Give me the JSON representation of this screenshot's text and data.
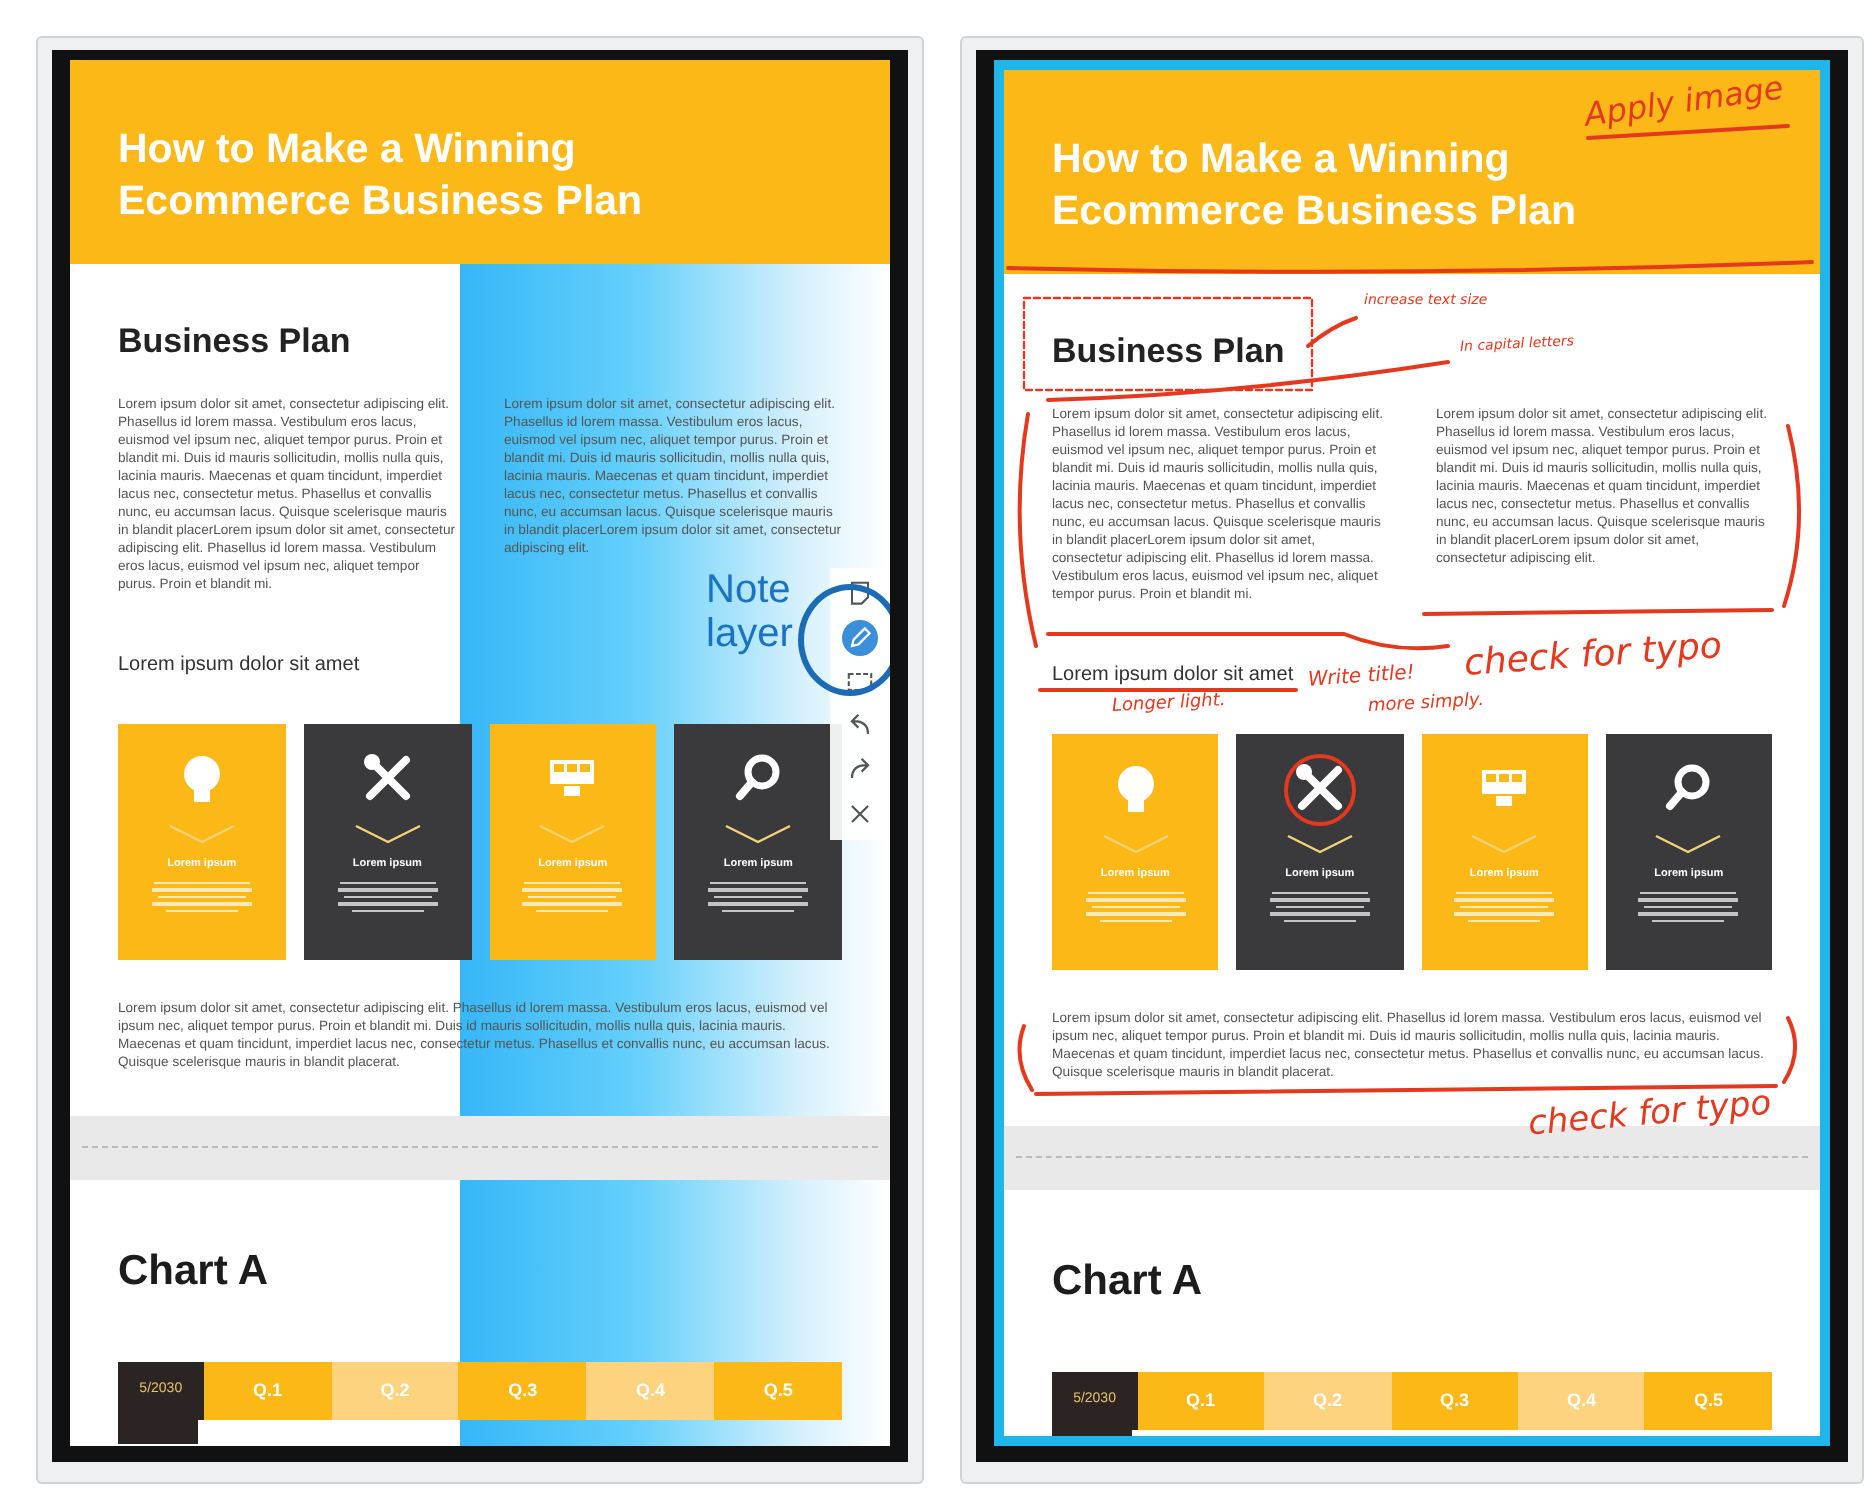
{
  "devices": [
    {
      "document": {
        "title_lines": [
          "How to Make a Winning",
          "Ecommerce Business Plan"
        ],
        "section_title": "Business Plan",
        "columns": [
          "Lorem ipsum dolor sit amet, consectetur adipiscing elit. Phasellus id lorem massa. Vestibulum eros lacus, euismod vel ipsum nec, aliquet tempor purus. Proin et blandit mi. Duis id mauris sollicitudin, mollis nulla quis, lacinia mauris. Maecenas et quam tincidunt, imperdiet lacus nec, consectetur metus. Phasellus et convallis nunc, eu accumsan lacus. Quisque scelerisque mauris in blandit placerLorem ipsum dolor sit amet, consectetur adipiscing elit. Phasellus id lorem massa. Vestibulum eros lacus, euismod vel ipsum nec, aliquet tempor purus. Proin et blandit mi.",
          "Lorem ipsum dolor sit amet, consectetur adipiscing elit. Phasellus id lorem massa. Vestibulum eros lacus, euismod vel ipsum nec, aliquet tempor purus. Proin et blandit mi. Duis id mauris sollicitudin, mollis nulla quis, lacinia mauris. Maecenas et quam tincidunt, imperdiet lacus nec, consectetur metus. Phasellus et convallis nunc, eu accumsan lacus. Quisque scelerisque mauris in blandit placerLorem ipsum dolor sit amet, consectetur adipiscing elit."
        ],
        "subheading": "Lorem ipsum dolor sit amet",
        "cards": [
          {
            "title": "Lorem ipsum",
            "kind": "light"
          },
          {
            "title": "Lorem ipsum",
            "kind": "dark"
          },
          {
            "title": "Lorem ipsum",
            "kind": "light"
          },
          {
            "title": "Lorem ipsum",
            "kind": "dark"
          }
        ],
        "paragraph": "Lorem ipsum dolor sit amet, consectetur adipiscing elit. Phasellus id lorem massa. Vestibulum eros lacus, euismod vel ipsum nec, aliquet tempor purus. Proin et blandit mi. Duis id mauris sollicitudin, mollis nulla quis, lacinia mauris. Maecenas et quam tincidunt, imperdiet lacus nec, consectetur metus. Phasellus et convallis nunc, eu accumsan lacus. Quisque scelerisque mauris in blandit placerat.",
        "chart_title": "Chart A",
        "table_header": [
          {
            "text": "5/2030",
            "kind": "label"
          },
          {
            "text": "Q.1",
            "kind": "strong"
          },
          {
            "text": "Q.2",
            "kind": "pale"
          },
          {
            "text": "Q.3",
            "kind": "strong"
          },
          {
            "text": "Q.4",
            "kind": "pale"
          },
          {
            "text": "Q.5",
            "kind": "strong"
          }
        ]
      },
      "note_layer": {
        "label": "Note layer",
        "tools": [
          {
            "kind": "note",
            "selected": false
          },
          {
            "kind": "pen",
            "selected": true
          },
          {
            "kind": "select",
            "selected": false
          },
          {
            "kind": "undo",
            "selected": false
          },
          {
            "kind": "redo",
            "selected": false
          },
          {
            "kind": "close",
            "selected": false
          }
        ]
      }
    },
    {
      "document": {
        "title_lines": [
          "How to Make a Winning",
          "Ecommerce Business Plan"
        ],
        "section_title": "Business Plan",
        "columns": [
          "Lorem ipsum dolor sit amet, consectetur adipiscing elit. Phasellus id lorem massa. Vestibulum eros lacus, euismod vel ipsum nec, aliquet tempor purus. Proin et blandit mi. Duis id mauris sollicitudin, mollis nulla quis, lacinia mauris. Maecenas et quam tincidunt, imperdiet lacus nec, consectetur metus. Phasellus et convallis nunc, eu accumsan lacus. Quisque scelerisque mauris in blandit placerLorem ipsum dolor sit amet, consectetur adipiscing elit. Phasellus id lorem massa. Vestibulum eros lacus, euismod vel ipsum nec, aliquet tempor purus. Proin et blandit mi.",
          "Lorem ipsum dolor sit amet, consectetur adipiscing elit. Phasellus id lorem massa. Vestibulum eros lacus, euismod vel ipsum nec, aliquet tempor purus. Proin et blandit mi. Duis id mauris sollicitudin, mollis nulla quis, lacinia mauris. Maecenas et quam tincidunt, imperdiet lacus nec, consectetur metus. Phasellus et convallis nunc, eu accumsan lacus. Quisque scelerisque mauris in blandit placerLorem ipsum dolor sit amet, consectetur adipiscing elit."
        ],
        "subheading": "Lorem ipsum dolor sit amet",
        "cards": [
          {
            "title": "Lorem ipsum",
            "kind": "light"
          },
          {
            "title": "Lorem ipsum",
            "kind": "dark"
          },
          {
            "title": "Lorem ipsum",
            "kind": "light"
          },
          {
            "title": "Lorem ipsum",
            "kind": "dark"
          }
        ],
        "paragraph": "Lorem ipsum dolor sit amet, consectetur adipiscing elit. Phasellus id lorem massa. Vestibulum eros lacus, euismod vel ipsum nec, aliquet tempor purus. Proin et blandit mi. Duis id mauris sollicitudin, mollis nulla quis, lacinia mauris. Maecenas et quam tincidunt, imperdiet lacus nec, consectetur metus. Phasellus et convallis nunc, eu accumsan lacus. Quisque scelerisque mauris in blandit placerat.",
        "chart_title": "Chart A",
        "table_header": [
          {
            "text": "5/2030",
            "kind": "label"
          },
          {
            "text": "Q.1",
            "kind": "strong"
          },
          {
            "text": "Q.2",
            "kind": "pale"
          },
          {
            "text": "Q.3",
            "kind": "strong"
          },
          {
            "text": "Q.4",
            "kind": "pale"
          },
          {
            "text": "Q.5",
            "kind": "strong"
          }
        ]
      },
      "annotations": [
        "Apply image",
        "increase text size",
        "In capital letters",
        "check for typo",
        "Write title!",
        "Longer light.",
        "more simply.",
        "check for typo"
      ]
    }
  ]
}
